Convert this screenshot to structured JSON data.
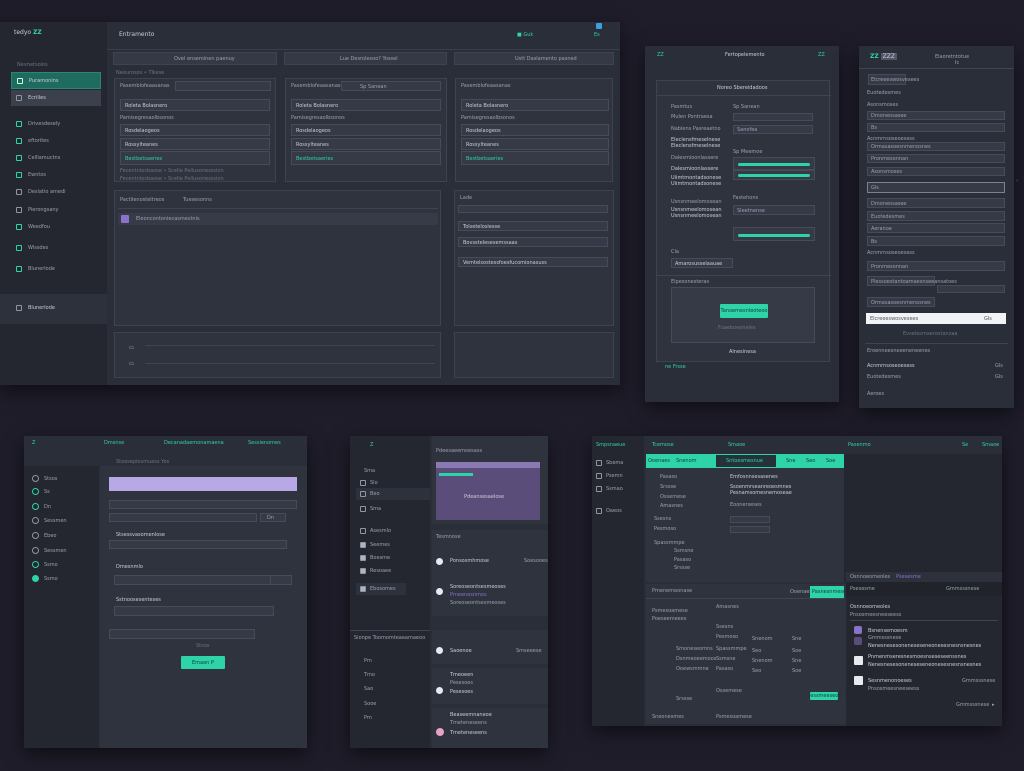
{
  "p1": {
    "logo_text": "tedyo",
    "logo_mark": "ZZ",
    "header_title": "Entramento",
    "header_right": "■ Guk",
    "header_right2": "Es",
    "sidebar_label": "Nevnetsolos",
    "sidebar_items": [
      "Puramonins",
      "Ecriiles",
      "Drivesdesely",
      "eftorites",
      "Celllamuctns",
      "Ewntos",
      "Deslatio amedi",
      "Pierongsany",
      "Weedfou",
      "Wissdes",
      "Blunerlode"
    ],
    "col_headers": [
      "Ovel enseminen paenuy",
      "Lue Desrolesoo? Yossel",
      "Ustt Daslamento pasned"
    ],
    "breadcrumb": "Neeurosos • Tlkese",
    "rows_label": "Pasemblofeaasanas",
    "rows": [
      "Pasemblofeaasanas",
      "Roleta Bolasnero",
      "Pamisegresaolbsonos",
      "Rosdelaogeos",
      "Rossylteanes",
      "Bestbetsaeries"
    ],
    "footer_note": "Fecentnlesbaose • Scelle Pellusonesssion",
    "section2_label": "Pactilenosteltreos",
    "section2_sub": "Tuesesonns",
    "section2_row": "Eleoncontoniecasmestnis",
    "right_box_label": "Lade",
    "right_box_items": [
      "Tolsetelosiesse",
      "Bovsstelesesemssaas",
      "Vemtelsostessfoesfucomionasuss"
    ]
  },
  "p2": {
    "logo": "ZZ",
    "title": "Fertopelemento",
    "head_btn": "ZZ",
    "top_label": "Noreo Sbereidadoos",
    "rows": [
      {
        "label": "Pasmtus",
        "right": "Sp Sanean"
      },
      {
        "label": "Mulen Pontraesa",
        "right": "Sanofea"
      },
      {
        "label": "Nablens Pasreaetno",
        "right": "Sp Meemoe"
      },
      {
        "label": "Eleclensfmeselnese",
        "right": ""
      },
      {
        "label": "Dalesmioonlassere",
        "right": "Fastehons"
      },
      {
        "label": "Uiimtmontadsonese",
        "right": "Sleetnense"
      },
      {
        "label": "Usnsnmeelomosean",
        "right": ""
      },
      {
        "label": "Cla",
        "right": ""
      }
    ],
    "field_label": "Amarosusselaauae",
    "bottom_label": "Elpesonesteras",
    "button": "Tanoemesnleoteoo",
    "under_btn": "Fuaeboeeneles",
    "under_btn2": "Alnesinesa",
    "footer": "ne Frsse"
  },
  "p3": {
    "logo": "ZZ",
    "logo_tag": "ZZZ",
    "top_right": "Elaoretntotue",
    "top_right2": "Ic",
    "button_label": "Elcreeeswosvesees",
    "fields": [
      "Euotedesmes",
      "Asonsmoses",
      "Acnmrnsoseoesess",
      "Ormasasoesnmenosnes",
      "Pronmesonnan",
      "Gls",
      "Dmoneosasee",
      "Aeranoe",
      "Bs",
      "Plessoestantoamaesnseeansatoes"
    ],
    "footer1": "Evselesmaerestanzaa",
    "footer2": "Eroenneesneeeneneenes",
    "footer3": "Aeroes"
  },
  "p4": {
    "logo": "Z",
    "top_items": [
      "Dmsnse",
      "Decanadaemonamaena",
      "Sessienomes"
    ],
    "sub_label": "Stoeseplesmuess Yos",
    "sidebar_items": [
      "Stsos",
      "Ss",
      "Dn",
      "Sessmen",
      "Ebeo",
      "Ssmo"
    ],
    "section_labels": [
      "Stsessvasomenlose",
      "Dmesnmlo",
      "Sstnoosesenteses"
    ],
    "button": "Emaen P"
  },
  "p5": {
    "logo": "Z",
    "top_label": "Pdeesaeemoesass",
    "purple_label": "Pdeansesaelose",
    "sidebar_items": [
      "Sma",
      "Slo",
      "Beo",
      "Asesmlo",
      "Seemes",
      "Boesme",
      "Resoaee",
      "Ebosomes"
    ],
    "footer_label": "Sionpe Toomomteaeamaeoo",
    "footer_items": [
      "Pm",
      "Tmo",
      "Sao",
      "Sooe"
    ],
    "msg_items": [
      {
        "title": "Ponsosmhmose",
        "sub": "Tesmnose",
        "right": "Soesooes"
      },
      {
        "title": "Soreoseontsesmeoses",
        "sub": "Pmeenesnmos",
        "right": ""
      },
      {
        "title": "Saoenoe",
        "sub": "Ssemodes",
        "right": "Smseeese"
      },
      {
        "title": "Tmeoeen",
        "sub": "Pesesoes",
        "right": ""
      },
      {
        "title": "Beaseemnaneoe",
        "sub": "Tmeteneseens",
        "right": ""
      }
    ]
  },
  "p6": {
    "logo": "Smpsnaeue",
    "nav": [
      "Tcemose",
      "Smaoe",
      "Pasenmo"
    ],
    "header_right": "Se",
    "top_tabs": [
      "Ooenaes",
      "Snenom",
      "Sntoesmesnue",
      "Sne",
      "Seo",
      "Soe"
    ],
    "sidebar": [
      "Sbema",
      "Psemn",
      "Ssmao",
      "Oaeos"
    ],
    "form_labels": [
      "Pasaso",
      "Srssse",
      "Ossemese",
      "Amasnes",
      "Ssesns",
      "Pesmoso",
      "Spassmmpe",
      "Ssmsne"
    ],
    "form_values": [
      "Emfosnnsesasenes",
      "Ssoenmrseanreoesmnes",
      "Pesnamsomesnemoseae",
      "Eoonerseses"
    ],
    "table_header": "Pmenemeonase",
    "table_header_right": "Pasnesnmesees",
    "table_rows": [
      "Psmesoamese",
      "Poeseemeees",
      "Smoneseomns",
      "Dsnmeoeemoos",
      "Ooewsmmne",
      "Sneonesmes"
    ],
    "chat_header": "Osnnoeomeoles",
    "chat_header2": "Psesesme",
    "chat_title": "Gmmsssnese",
    "chat_sub": "Pnsosmeesneeseess",
    "chat_items": [
      "Bsnensemoesm",
      "Nenesnesesoneneseseneonesesnesnsnesnes",
      "Pnmenmseresnesmoesnseseseenssnes",
      "Sesnmenonoeses"
    ],
    "chat_btn": "Sessmeeseos"
  }
}
